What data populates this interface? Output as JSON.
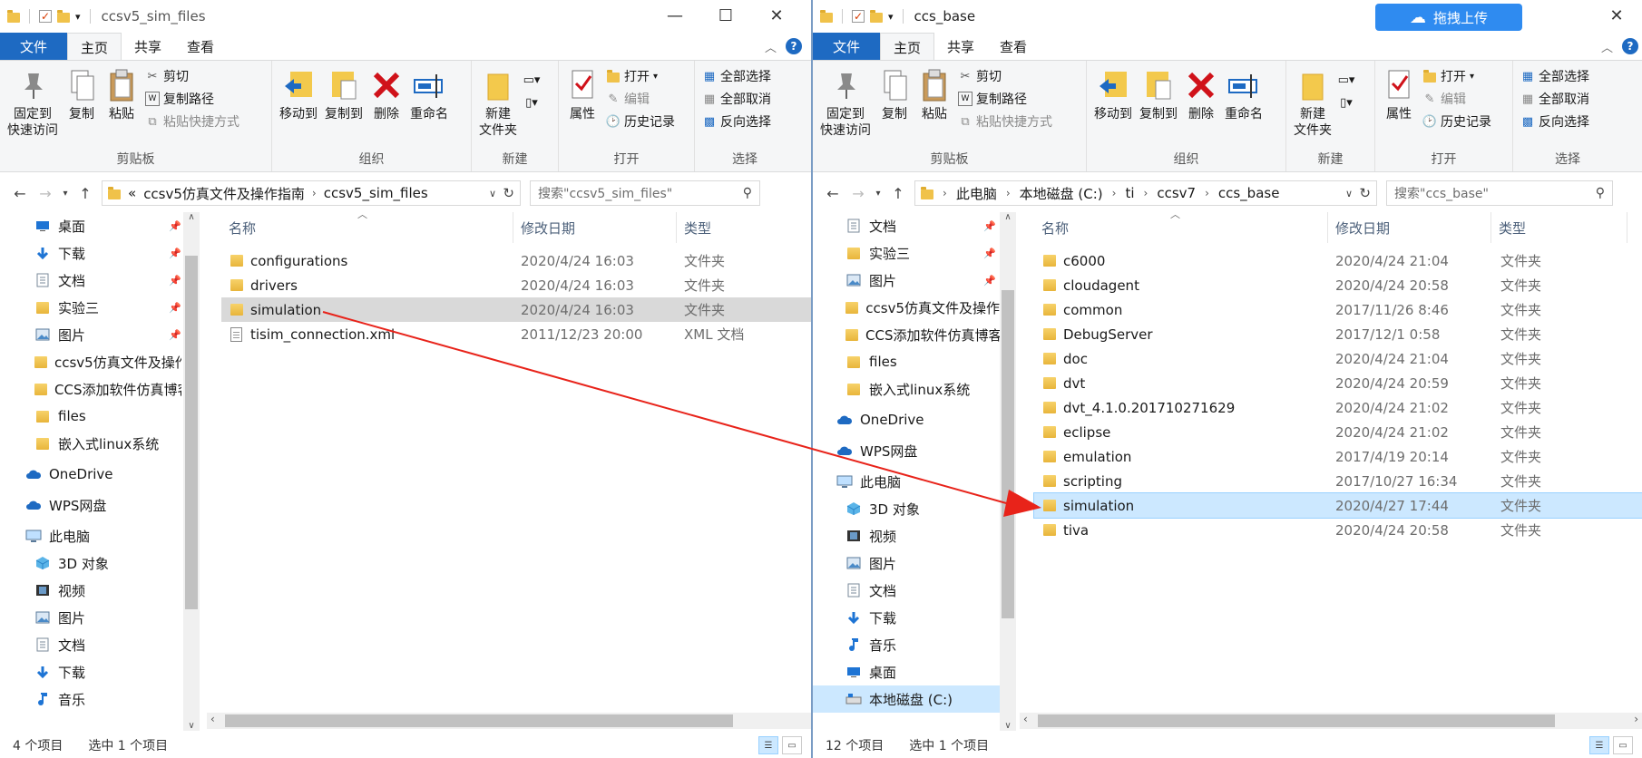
{
  "left": {
    "title": "ccsv5_sim_files",
    "tabs": {
      "file": "文件",
      "home": "主页",
      "share": "共享",
      "view": "查看"
    },
    "ribbon": {
      "clipboard": {
        "label": "剪贴板",
        "pin": "固定到\n快速访问",
        "copy": "复制",
        "paste": "粘贴",
        "cut": "剪切",
        "copy_path": "复制路径",
        "paste_shortcut": "粘贴快捷方式"
      },
      "organize": {
        "label": "组织",
        "move_to": "移动到",
        "copy_to": "复制到",
        "delete": "删除",
        "rename": "重命名"
      },
      "new": {
        "label": "新建",
        "new_folder": "新建\n文件夹"
      },
      "open": {
        "label": "打开",
        "properties": "属性",
        "open": "打开",
        "edit": "编辑",
        "history": "历史记录"
      },
      "select": {
        "label": "选择",
        "select_all": "全部选择",
        "select_none": "全部取消",
        "invert": "反向选择"
      }
    },
    "address": {
      "overflow": "«",
      "crumbs": [
        "ccsv5仿真文件及操作指南",
        "ccsv5_sim_files"
      ]
    },
    "search_placeholder": "搜索\"ccsv5_sim_files\"",
    "nav": [
      {
        "label": "桌面",
        "icon": "desktop-icon",
        "pinned": true
      },
      {
        "label": "下载",
        "icon": "download-icon",
        "pinned": true
      },
      {
        "label": "文档",
        "icon": "document-icon",
        "pinned": true
      },
      {
        "label": "实验三",
        "icon": "folder-icon",
        "pinned": true
      },
      {
        "label": "图片",
        "icon": "pictures-icon",
        "pinned": true
      },
      {
        "label": "ccsv5仿真文件及操作",
        "icon": "folder-icon",
        "pinned": false
      },
      {
        "label": "CCS添加软件仿真博客",
        "icon": "folder-icon",
        "pinned": false
      },
      {
        "label": "files",
        "icon": "folder-icon",
        "pinned": false
      },
      {
        "label": "嵌入式linux系统",
        "icon": "folder-icon",
        "pinned": false
      },
      {
        "label": "OneDrive",
        "icon": "cloud-icon",
        "pinned": false
      },
      {
        "label": "WPS网盘",
        "icon": "cloud-icon",
        "pinned": false
      },
      {
        "label": "此电脑",
        "icon": "computer-icon",
        "pinned": false
      },
      {
        "label": "3D 对象",
        "icon": "3d-objects-icon",
        "pinned": false
      },
      {
        "label": "视频",
        "icon": "video-icon",
        "pinned": false
      },
      {
        "label": "图片",
        "icon": "pictures-icon",
        "pinned": false
      },
      {
        "label": "文档",
        "icon": "document-icon",
        "pinned": false
      },
      {
        "label": "下载",
        "icon": "download-icon",
        "pinned": false
      },
      {
        "label": "音乐",
        "icon": "music-icon",
        "pinned": false
      }
    ],
    "columns": {
      "name": "名称",
      "date": "修改日期",
      "type": "类型"
    },
    "files": [
      {
        "name": "configurations",
        "date": "2020/4/24 16:03",
        "type": "文件夹",
        "icon": "folder-icon"
      },
      {
        "name": "drivers",
        "date": "2020/4/24 16:03",
        "type": "文件夹",
        "icon": "folder-icon"
      },
      {
        "name": "simulation",
        "date": "2020/4/24 16:03",
        "type": "文件夹",
        "icon": "folder-icon"
      },
      {
        "name": "tisim_connection.xml",
        "date": "2011/12/23 20:00",
        "type": "XML 文档",
        "icon": "xml-file-icon"
      }
    ],
    "status": {
      "count": "4 个项目",
      "selected": "选中 1 个项目"
    }
  },
  "right": {
    "title": "ccs_base",
    "upload_label": "拖拽上传",
    "tabs": {
      "file": "文件",
      "home": "主页",
      "share": "共享",
      "view": "查看"
    },
    "ribbon": {
      "clipboard": {
        "label": "剪贴板",
        "pin": "固定到\n快速访问",
        "copy": "复制",
        "paste": "粘贴",
        "cut": "剪切",
        "copy_path": "复制路径",
        "paste_shortcut": "粘贴快捷方式"
      },
      "organize": {
        "label": "组织",
        "move_to": "移动到",
        "copy_to": "复制到",
        "delete": "删除",
        "rename": "重命名"
      },
      "new": {
        "label": "新建",
        "new_folder": "新建\n文件夹"
      },
      "open": {
        "label": "打开",
        "properties": "属性",
        "open": "打开",
        "edit": "编辑",
        "history": "历史记录"
      },
      "select": {
        "label": "选择",
        "select_all": "全部选择",
        "select_none": "全部取消",
        "invert": "反向选择"
      }
    },
    "address": {
      "crumbs": [
        "此电脑",
        "本地磁盘 (C:)",
        "ti",
        "ccsv7",
        "ccs_base"
      ]
    },
    "search_placeholder": "搜索\"ccs_base\"",
    "nav": [
      {
        "label": "文档",
        "icon": "document-icon",
        "pinned": true
      },
      {
        "label": "实验三",
        "icon": "folder-icon",
        "pinned": true
      },
      {
        "label": "图片",
        "icon": "pictures-icon",
        "pinned": true
      },
      {
        "label": "ccsv5仿真文件及操作",
        "icon": "folder-icon",
        "pinned": false
      },
      {
        "label": "CCS添加软件仿真博客",
        "icon": "folder-icon",
        "pinned": false
      },
      {
        "label": "files",
        "icon": "folder-icon",
        "pinned": false
      },
      {
        "label": "嵌入式linux系统",
        "icon": "folder-icon",
        "pinned": false
      },
      {
        "label": "OneDrive",
        "icon": "cloud-icon",
        "pinned": false
      },
      {
        "label": "WPS网盘",
        "icon": "cloud-icon",
        "pinned": false
      },
      {
        "label": "此电脑",
        "icon": "computer-icon",
        "pinned": false
      },
      {
        "label": "3D 对象",
        "icon": "3d-objects-icon",
        "pinned": false
      },
      {
        "label": "视频",
        "icon": "video-icon",
        "pinned": false
      },
      {
        "label": "图片",
        "icon": "pictures-icon",
        "pinned": false
      },
      {
        "label": "文档",
        "icon": "document-icon",
        "pinned": false
      },
      {
        "label": "下载",
        "icon": "download-icon",
        "pinned": false
      },
      {
        "label": "音乐",
        "icon": "music-icon",
        "pinned": false
      },
      {
        "label": "桌面",
        "icon": "desktop-icon",
        "pinned": false
      },
      {
        "label": "本地磁盘 (C:)",
        "icon": "drive-icon",
        "pinned": false
      }
    ],
    "columns": {
      "name": "名称",
      "date": "修改日期",
      "type": "类型"
    },
    "files": [
      {
        "name": "c6000",
        "date": "2020/4/24 21:04",
        "type": "文件夹"
      },
      {
        "name": "cloudagent",
        "date": "2020/4/24 20:58",
        "type": "文件夹"
      },
      {
        "name": "common",
        "date": "2017/11/26 8:46",
        "type": "文件夹"
      },
      {
        "name": "DebugServer",
        "date": "2017/12/1 0:58",
        "type": "文件夹"
      },
      {
        "name": "doc",
        "date": "2020/4/24 21:04",
        "type": "文件夹"
      },
      {
        "name": "dvt",
        "date": "2020/4/24 20:59",
        "type": "文件夹"
      },
      {
        "name": "dvt_4.1.0.201710271629",
        "date": "2020/4/24 21:02",
        "type": "文件夹"
      },
      {
        "name": "eclipse",
        "date": "2020/4/24 21:02",
        "type": "文件夹"
      },
      {
        "name": "emulation",
        "date": "2017/4/19 20:14",
        "type": "文件夹"
      },
      {
        "name": "scripting",
        "date": "2017/10/27 16:34",
        "type": "文件夹"
      },
      {
        "name": "simulation",
        "date": "2020/4/27 17:44",
        "type": "文件夹"
      },
      {
        "name": "tiva",
        "date": "2020/4/24 20:58",
        "type": "文件夹"
      }
    ],
    "status": {
      "count": "12 个项目",
      "selected": "选中 1 个项目"
    }
  },
  "colors": {
    "accent": "#1e6ac2",
    "selection": "#cce8ff",
    "arrow": "#e8231a"
  }
}
